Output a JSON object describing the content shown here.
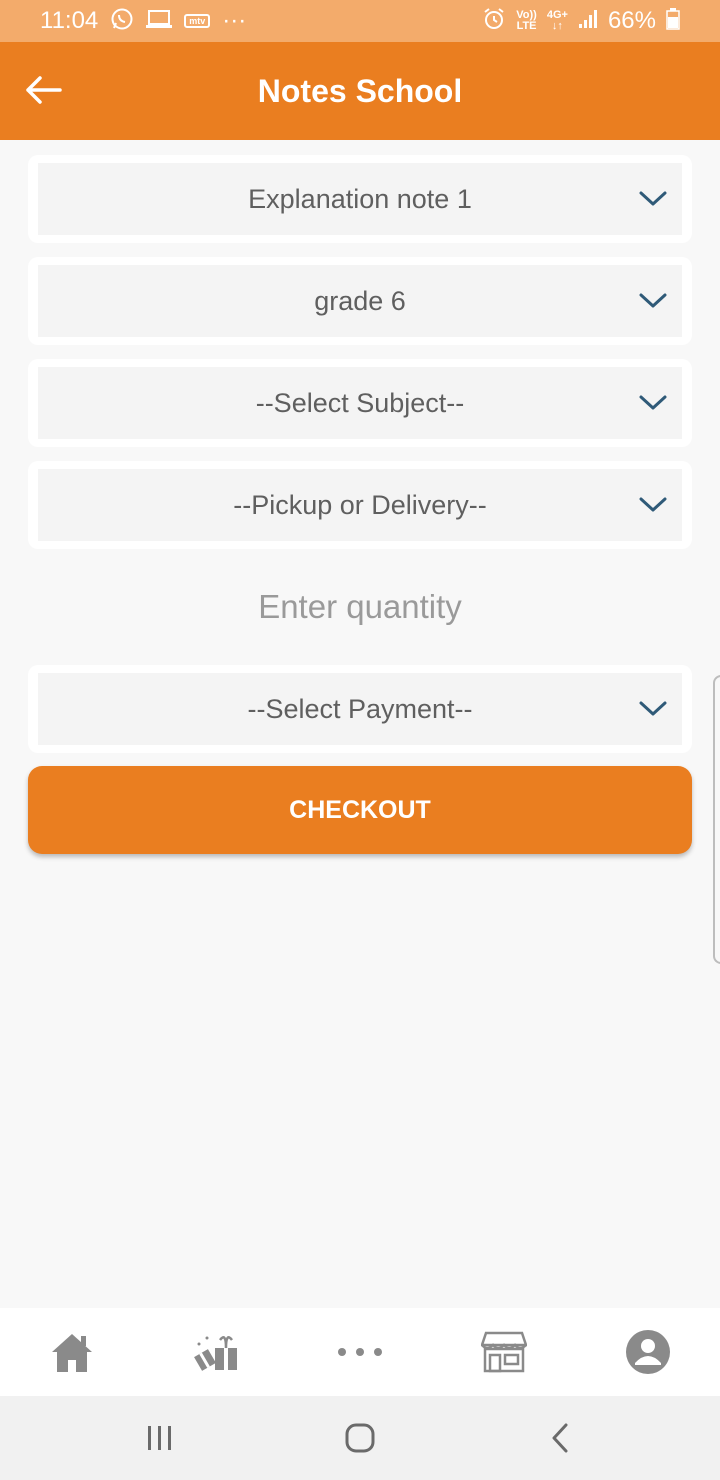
{
  "status_bar": {
    "time": "11:04",
    "mtv_label": "mtv",
    "more": "···",
    "volte_top": "Vo))",
    "volte_bottom": "LTE",
    "network_top": "4G+",
    "network_bottom": "↓↑",
    "battery": "66%"
  },
  "app_bar": {
    "title": "Notes School",
    "back_icon": "arrow-left-icon"
  },
  "form": {
    "note_type": {
      "value": "Explanation note 1"
    },
    "grade": {
      "value": "grade 6"
    },
    "subject": {
      "value": "--Select Subject--"
    },
    "delivery": {
      "value": "--Pickup or Delivery--"
    },
    "quantity": {
      "placeholder": "Enter quantity",
      "value": ""
    },
    "payment": {
      "value": "--Select Payment--"
    },
    "checkout_label": "CHECKOUT"
  },
  "bottom_nav": {
    "items": [
      "home-icon",
      "gift-icon",
      "more-dots-icon",
      "store-icon",
      "profile-icon"
    ]
  },
  "system_nav": {
    "items": [
      "recents-icon",
      "home-button-icon",
      "back-icon"
    ]
  },
  "colors": {
    "primary": "#ea7e20",
    "status_bar": "#f3ab6b",
    "chevron": "#2f5a78",
    "nav_icon": "#8a8a8a"
  }
}
